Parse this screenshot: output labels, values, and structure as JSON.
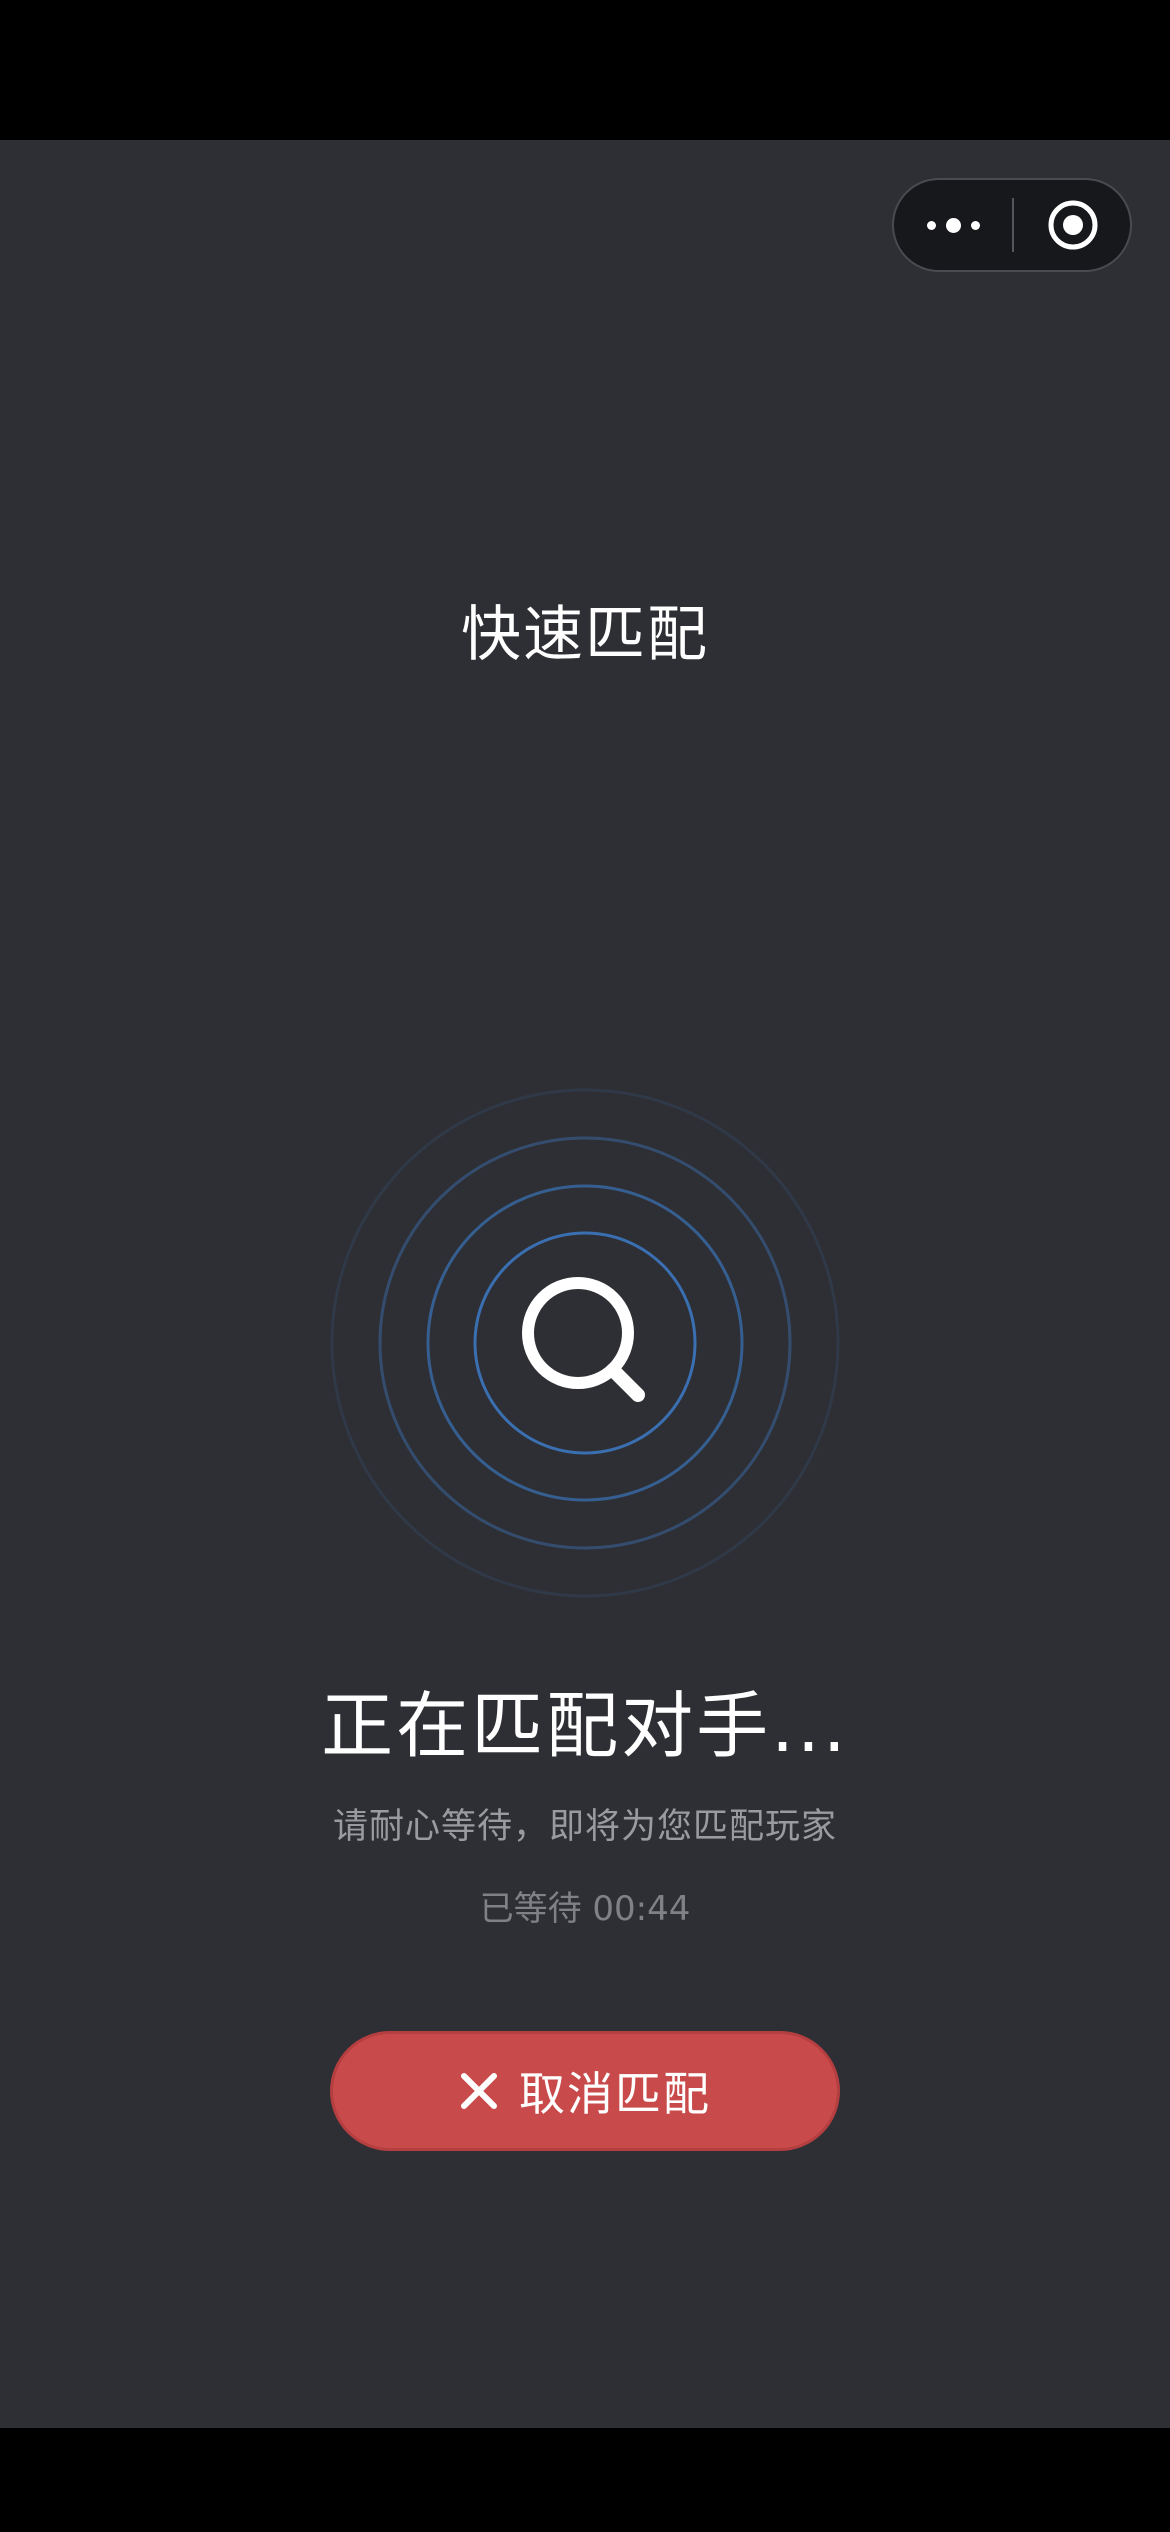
{
  "header": {
    "title": "快速匹配",
    "capsule": {
      "more_icon": "more-dots-icon",
      "close_icon": "close-target-icon"
    }
  },
  "main": {
    "search_icon": "search-icon",
    "status_title": "正在匹配对手...",
    "status_subtitle": "请耐心等待，即将为您匹配玩家",
    "wait_time": "已等待 00:44",
    "cancel": {
      "icon": "close-icon",
      "label": "取消匹配"
    }
  },
  "colors": {
    "background": "#2e2f34",
    "radar_ring": "#3b73b9",
    "cancel_button": "#c94a4a",
    "text_primary": "#ffffff",
    "text_secondary": "#9a9ba1"
  }
}
